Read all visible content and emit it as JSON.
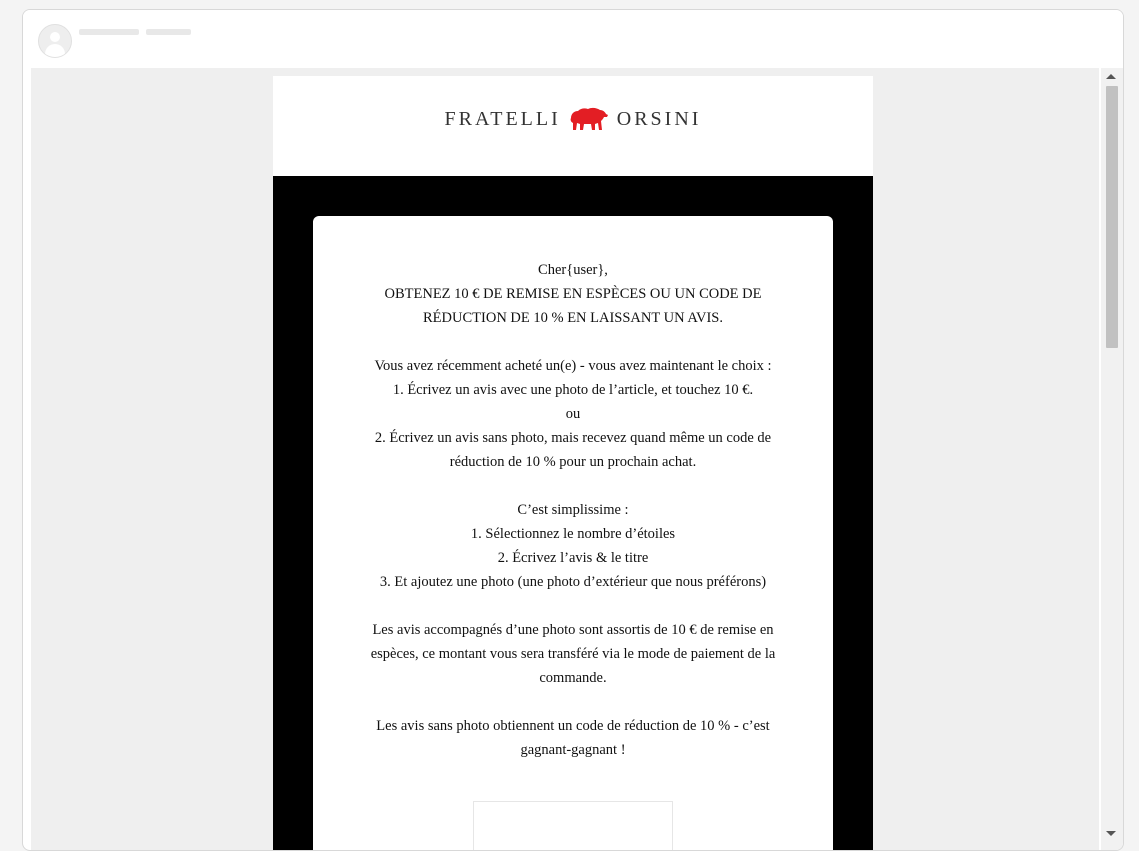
{
  "brand": {
    "left_word": "FRATELLI",
    "right_word": "ORSINI",
    "accent_color": "#e31e24"
  },
  "greeting": "Cher{user},",
  "headline_1": "OBTENEZ 10 € DE REMISE EN ESPÈCES OU UN CODE DE",
  "headline_2": "RÉDUCTION DE 10 % EN LAISSANT UN AVIS.",
  "choice_intro": "Vous avez récemment acheté un(e) - vous avez maintenant le choix :",
  "option_1": "1. Écrivez un avis avec une photo de l’article, et touchez 10 €.",
  "or": "ou",
  "option_2_line1": "2. Écrivez un avis sans photo, mais recevez quand même un code de",
  "option_2_line2": "réduction de 10 % pour un prochain achat.",
  "steps_intro": "C’est simplissime :",
  "step_1": "1. Sélectionnez le nombre d’étoiles",
  "step_2": "2. Écrivez l’avis & le titre",
  "step_3": "3. Et ajoutez une photo (une photo d’extérieur que nous préférons)",
  "photo_line1": "Les avis accompagnés d’une photo sont assortis de 10 € de remise en",
  "photo_line2": "espèces, ce montant vous sera transféré via le mode de paiement de la",
  "photo_line3": "commande.",
  "nophoto_line1": "Les avis sans photo obtiennent un code de réduction de 10 % - c’est",
  "nophoto_line2": "gagnant-gagnant !"
}
